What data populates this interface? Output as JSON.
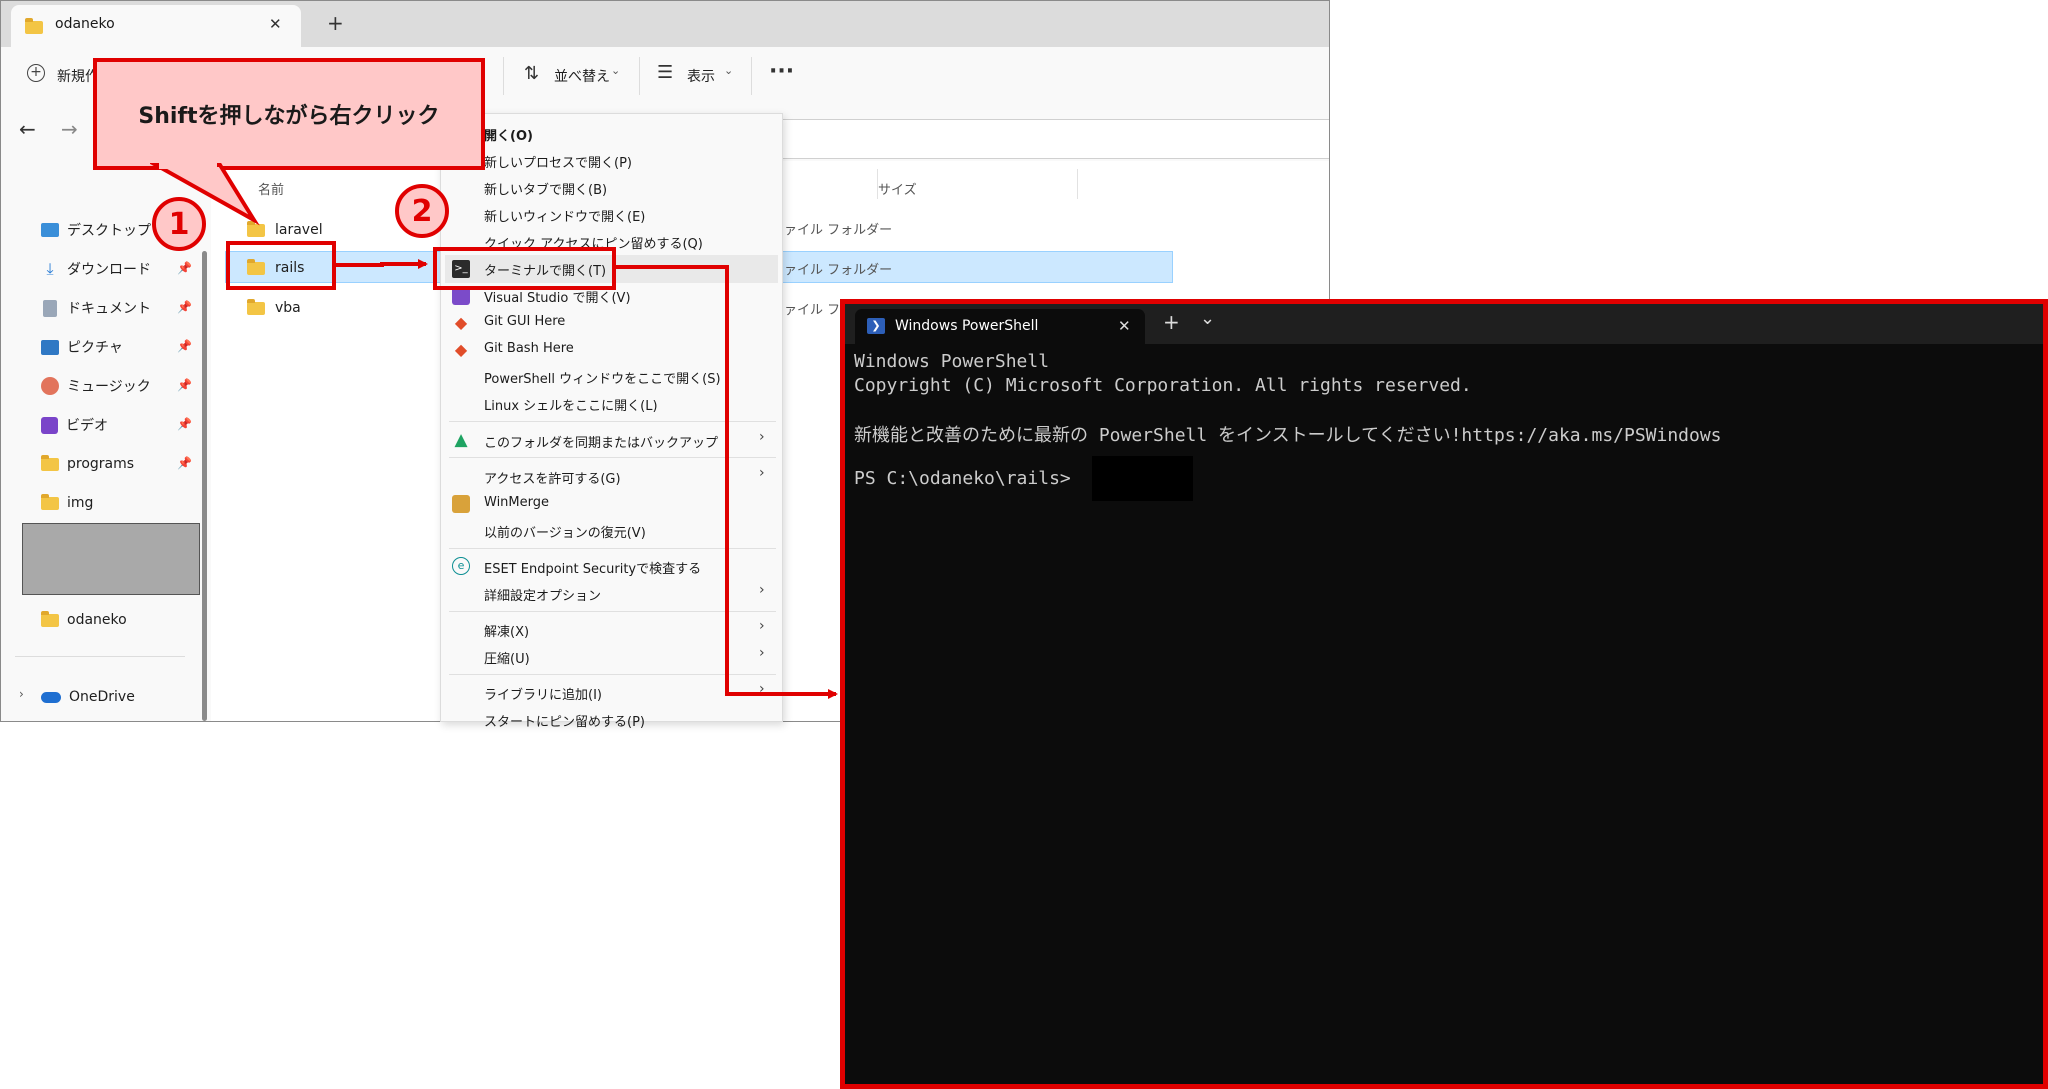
{
  "explorer": {
    "tab_title": "odaneko",
    "tab_close": "✕",
    "new_tab": "+",
    "toolbar": {
      "new_label": "新規作成",
      "sort_label": "並べ替え",
      "view_label": "表示",
      "more": "···"
    },
    "columns": {
      "name": "名前",
      "size": "サイズ"
    },
    "sidebar": [
      {
        "label": "デスクトップ",
        "icon": "desktop-icon",
        "pinned": false
      },
      {
        "label": "ダウンロード",
        "icon": "download-icon",
        "pinned": true
      },
      {
        "label": "ドキュメント",
        "icon": "document-icon",
        "pinned": true
      },
      {
        "label": "ピクチャ",
        "icon": "picture-icon",
        "pinned": true
      },
      {
        "label": "ミュージック",
        "icon": "music-icon",
        "pinned": true
      },
      {
        "label": "ビデオ",
        "icon": "video-icon",
        "pinned": true
      },
      {
        "label": "programs",
        "icon": "folder-icon",
        "pinned": true
      },
      {
        "label": "img",
        "icon": "folder-icon",
        "pinned": false
      }
    ],
    "sidebar_odaneko": "odaneko",
    "sidebar_onedrive": "OneDrive",
    "files": [
      {
        "name": "laravel",
        "type": "ファイル フォルダー"
      },
      {
        "name": "rails",
        "type": "ファイル フォルダー"
      },
      {
        "name": "vba",
        "type": "ファイル フォルダー"
      }
    ]
  },
  "callout": {
    "text": "Shiftを押しながら右クリック",
    "step1": "1",
    "step2": "2"
  },
  "context_menu": {
    "items": [
      {
        "label": "開く(O)",
        "bold": true
      },
      {
        "label": "新しいプロセスで開く(P)"
      },
      {
        "label": "新しいタブで開く(B)"
      },
      {
        "label": "新しいウィンドウで開く(E)"
      },
      {
        "label": "クイック アクセスにピン留めする(Q)"
      },
      {
        "label": "ターミナルで開く(T)",
        "icon": "terminal-icon"
      },
      {
        "label": "Visual Studio で開く(V)",
        "icon": "visual-studio-icon"
      },
      {
        "label": "Git GUI Here",
        "icon": "git-icon"
      },
      {
        "label": "Git Bash Here",
        "icon": "git-icon"
      },
      {
        "label": "PowerShell ウィンドウをここで開く(S)"
      },
      {
        "label": "Linux シェルをここに開く(L)"
      },
      {
        "label": "このフォルダを同期またはバックアップ",
        "icon": "google-drive-icon",
        "submenu": true
      },
      {
        "label": "アクセスを許可する(G)",
        "submenu": true
      },
      {
        "label": "WinMerge",
        "icon": "winmerge-icon"
      },
      {
        "label": "以前のバージョンの復元(V)"
      },
      {
        "label": "ESET Endpoint Securityで検査する",
        "icon": "eset-icon"
      },
      {
        "label": "詳細設定オプション",
        "submenu": true
      },
      {
        "label": "解凍(X)",
        "submenu": true
      },
      {
        "label": "圧縮(U)",
        "submenu": true
      },
      {
        "label": "ライブラリに追加(I)",
        "submenu": true
      },
      {
        "label": "スタートにピン留めする(P)"
      }
    ]
  },
  "terminal": {
    "tab_title": "Windows PowerShell",
    "tab_close": "✕",
    "new_tab": "+",
    "dropdown": "⌄",
    "lines": [
      "Windows PowerShell",
      "Copyright (C) Microsoft Corporation. All rights reserved.",
      "",
      "新機能と改善のために最新の PowerShell をインストールしてください!https://aka.ms/PSWindows",
      "",
      "PS C:\\odaneko\\rails>"
    ]
  }
}
